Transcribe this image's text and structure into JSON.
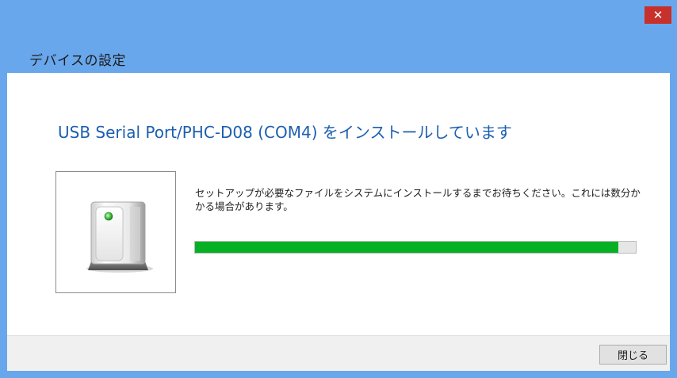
{
  "window": {
    "title": "デバイスの設定",
    "close_glyph": "✕"
  },
  "main": {
    "heading": "USB Serial Port/PHC-D08 (COM4) をインストールしています",
    "description": "セットアップが必要なファイルをシステムにインストールするまでお待ちください。これには数分かかる場合があります。",
    "device_icon": "usb-device-icon",
    "progress_fraction": 0.96
  },
  "footer": {
    "close_label": "閉じる"
  },
  "colors": {
    "titlebar": "#69a7ec",
    "close_button": "#c7302b",
    "heading": "#1c5fb0",
    "progress": "#06b025"
  }
}
